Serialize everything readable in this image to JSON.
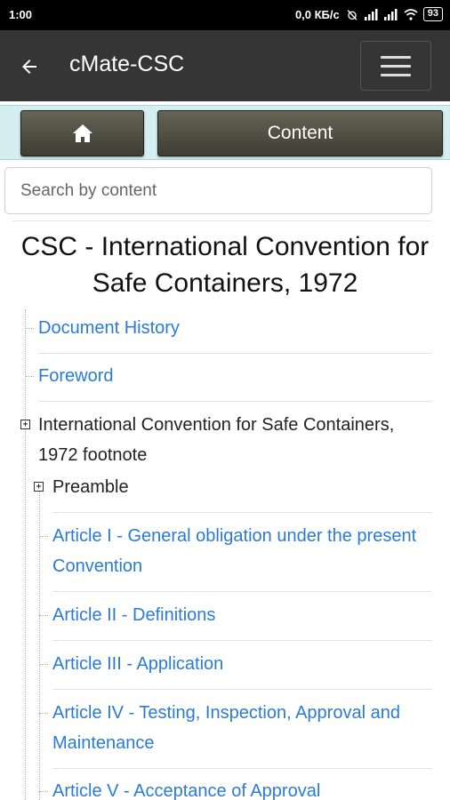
{
  "status_bar": {
    "time": "1:00",
    "net_speed": "0,0 КБ/с",
    "battery": "93"
  },
  "app_bar": {
    "back_icon": "arrow-left-icon",
    "title": "cMate-CSC",
    "menu_icon": "hamburger-menu-icon"
  },
  "toolbar": {
    "home_icon": "home-icon",
    "content_label": "Content"
  },
  "search": {
    "placeholder": "Search by content",
    "value": ""
  },
  "document": {
    "title": "CSC - International Convention for Safe Containers, 1972"
  },
  "tree": {
    "document_history": "Document History",
    "foreword": "Foreword",
    "convention": "International Convention for Safe Containers, 1972 footnote",
    "preamble": "Preamble",
    "article_1": "Article I - General obligation under the present Convention",
    "article_2": "Article II - Definitions",
    "article_3": "Article III - Application",
    "article_4": "Article IV - Testing, Inspection, Approval and Maintenance",
    "article_5": "Article V - Acceptance of Approval",
    "expand_symbol": "+"
  },
  "colors": {
    "app_bar": "#353535",
    "toolbar_bg": "#d5eef2",
    "link": "#2a7bd5"
  }
}
